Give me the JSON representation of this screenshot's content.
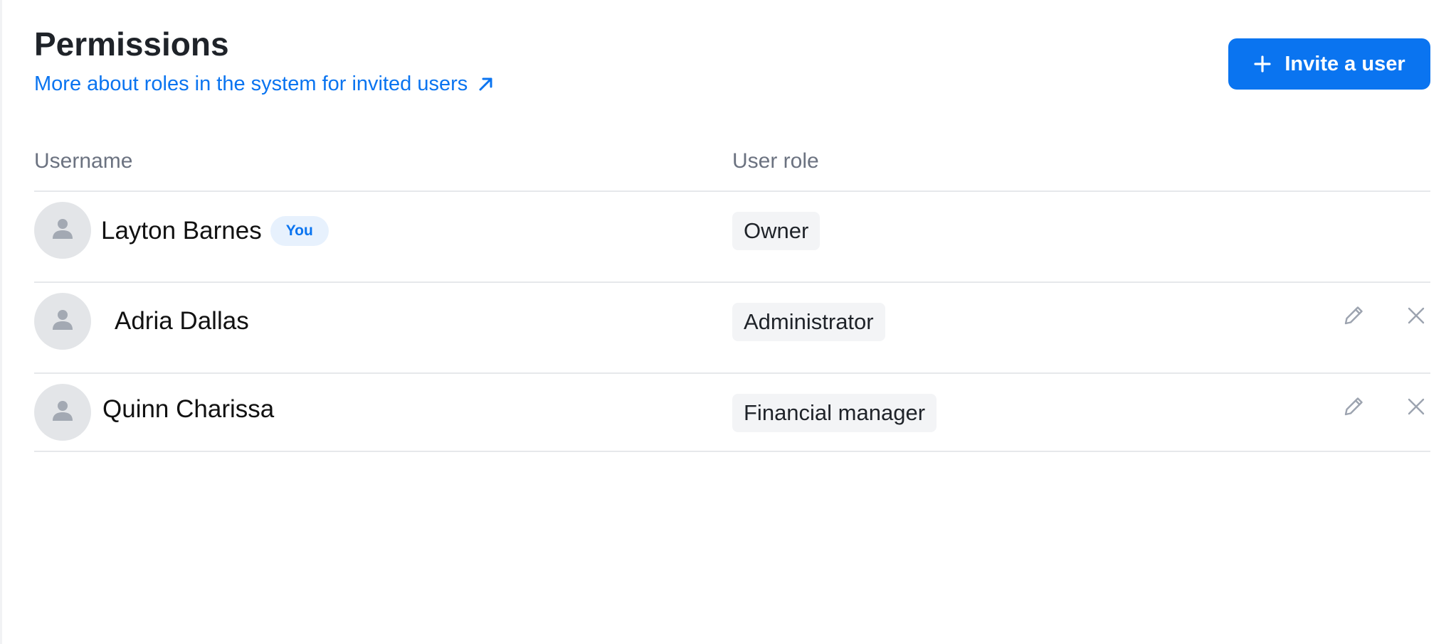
{
  "header": {
    "title": "Permissions",
    "roles_link_text": "More about roles in the system for invited users",
    "roles_link_icon": "external-arrow-icon",
    "invite_button_label": "Invite a user",
    "invite_button_icon": "plus-icon"
  },
  "table": {
    "columns": [
      "Username",
      "User role"
    ],
    "rows": [
      {
        "name": "Layton Barnes",
        "badge": "You",
        "role": "Owner",
        "editable": false
      },
      {
        "name": "Adria Dallas",
        "badge": "",
        "role": "Administrator",
        "editable": true
      },
      {
        "name": "Quinn Charissa",
        "badge": "",
        "role": "Financial manager",
        "editable": true
      }
    ]
  },
  "colors": {
    "accent": "#0a74f0",
    "badge_bg": "#e7f1fd",
    "chip_bg": "#f3f4f6",
    "avatar_bg": "#e3e5e8",
    "muted_text": "#6b7280",
    "icon_gray": "#9ca3af"
  },
  "icons": {
    "avatar": "user-silhouette-icon",
    "edit": "pencil-icon",
    "remove": "close-icon"
  }
}
